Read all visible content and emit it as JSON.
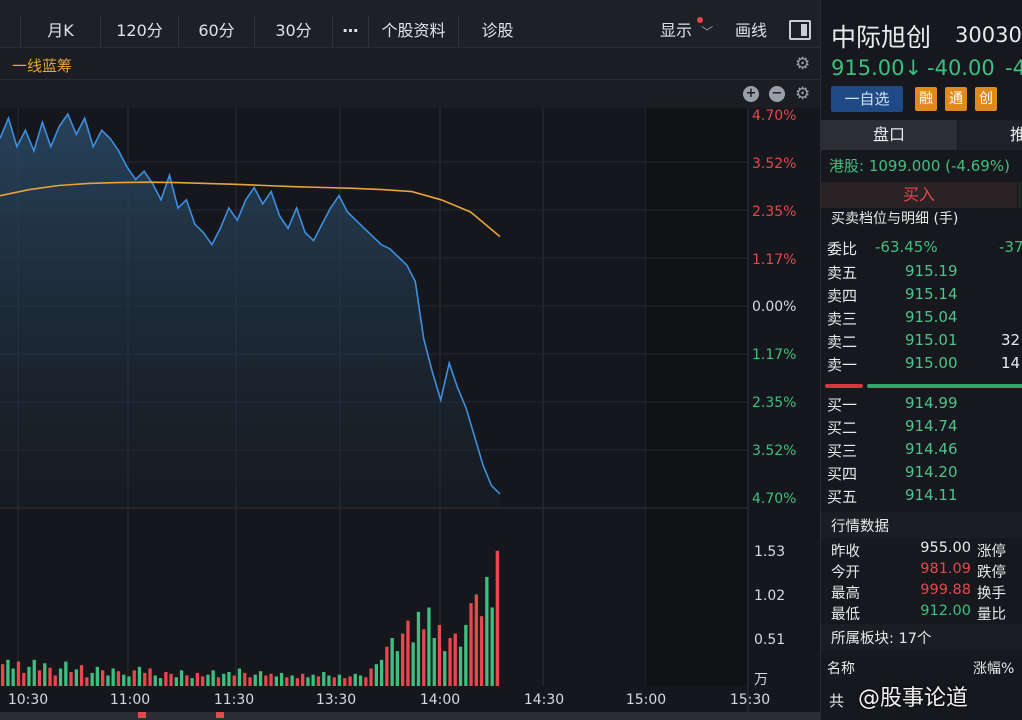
{
  "toolbar": {
    "buttons": [
      "月K",
      "120分",
      "60分",
      "30分",
      "⋯",
      "个股资料",
      "诊股"
    ],
    "display_label": "显示",
    "draw_label": "画线"
  },
  "indicator": {
    "name": "一线蓝筹"
  },
  "colors": {
    "up": "#e5484d",
    "down": "#3fbf7f",
    "price_line": "#3d8fe0",
    "avg_line": "#e8a33a",
    "accent": "#e8a33a"
  },
  "chart_data": [
    {
      "type": "line",
      "title": "",
      "x": [
        "10:30",
        "11:00",
        "11:30",
        "13:30",
        "14:00",
        "14:30",
        "15:00",
        "15:30"
      ],
      "y_tick_labels_up": [
        "4.70%",
        "3.52%",
        "2.35%",
        "1.17%"
      ],
      "y_tick_labels_mid": "0.00%",
      "y_tick_labels_down": [
        "1.17%",
        "2.35%",
        "3.52%",
        "4.70%"
      ],
      "ylim_percent": [
        -4.7,
        4.7
      ],
      "series": [
        {
          "values_percent": [
            4.1,
            4.6,
            3.9,
            4.3,
            3.8,
            4.5,
            3.9,
            4.4,
            4.7,
            4.2,
            4.6,
            3.9,
            4.3,
            4.1,
            3.8,
            3.4,
            3.1,
            3.3,
            3.0,
            2.6,
            3.2,
            2.4,
            2.6,
            2.0,
            1.8,
            1.5,
            1.9,
            2.4,
            2.1,
            2.6,
            2.9,
            2.5,
            2.8,
            2.2,
            1.9,
            2.4,
            1.8,
            1.6,
            2.0,
            2.4,
            2.7,
            2.3,
            2.1,
            1.9,
            1.7,
            1.5,
            1.4,
            1.2,
            1.0,
            0.6,
            -0.8,
            -1.6,
            -2.3,
            -1.4,
            -2.0,
            -2.5,
            -3.2,
            -3.9,
            -4.4,
            -4.6
          ],
          "color": "#3d8fe0"
        },
        {
          "values_percent": [
            2.7,
            2.85,
            2.95,
            3.0,
            3.02,
            3.03,
            3.02,
            3.0,
            2.98,
            2.95,
            2.92,
            2.9,
            2.88,
            2.85,
            2.8,
            2.6,
            2.3,
            1.7
          ],
          "color": "#e8a33a"
        }
      ]
    },
    {
      "type": "bar",
      "title": "",
      "ylabel": "万",
      "y_tick_labels": [
        "1.53",
        "1.02",
        "0.51"
      ],
      "ylim": [
        0,
        2.04
      ],
      "values": [
        0.25,
        0.3,
        0.2,
        0.28,
        0.15,
        0.22,
        0.3,
        0.18,
        0.26,
        0.21,
        0.12,
        0.2,
        0.28,
        0.16,
        0.19,
        0.24,
        0.1,
        0.15,
        0.22,
        0.18,
        0.12,
        0.2,
        0.17,
        0.13,
        0.11,
        0.18,
        0.22,
        0.15,
        0.2,
        0.12,
        0.09,
        0.16,
        0.14,
        0.1,
        0.18,
        0.12,
        0.09,
        0.15,
        0.11,
        0.13,
        0.18,
        0.1,
        0.14,
        0.16,
        0.12,
        0.2,
        0.15,
        0.1,
        0.13,
        0.17,
        0.12,
        0.14,
        0.11,
        0.15,
        0.1,
        0.12,
        0.09,
        0.14,
        0.1,
        0.13,
        0.11,
        0.16,
        0.12,
        0.1,
        0.13,
        0.09,
        0.11,
        0.14,
        0.12,
        0.1,
        0.2,
        0.25,
        0.3,
        0.45,
        0.55,
        0.4,
        0.6,
        0.75,
        0.5,
        0.85,
        0.65,
        0.9,
        0.55,
        0.7,
        0.4,
        0.55,
        0.6,
        0.45,
        0.7,
        0.95,
        1.05,
        0.8,
        1.25,
        0.9,
        1.55
      ],
      "up_down": "udduudduduudduduudduddudduduudduudduduuddudduduudduudduduuddudduduudduuddudduuddudduduudduu"
    }
  ],
  "stock": {
    "name": "中际旭创",
    "code": "30030",
    "price": "915.00↓",
    "change": "-40.00",
    "change_pct": "-4.",
    "watchlist_label": "一自选",
    "tags": [
      "融",
      "通",
      "创"
    ]
  },
  "panel_tabs": {
    "active": "盘口",
    "other": "推"
  },
  "hk": {
    "text": "港股: 1099.000 (-4.69%)"
  },
  "buy_label": "买入",
  "order_book_title": "买卖档位与明细 (手)",
  "weibi": {
    "label": "委比",
    "value": "-63.45%",
    "extra": "-37"
  },
  "asks": [
    {
      "label": "卖五",
      "price": "915.19",
      "vol": ""
    },
    {
      "label": "卖四",
      "price": "915.14",
      "vol": ""
    },
    {
      "label": "卖三",
      "price": "915.04",
      "vol": ""
    },
    {
      "label": "卖二",
      "price": "915.01",
      "vol": "32"
    },
    {
      "label": "卖一",
      "price": "915.00",
      "vol": "14"
    }
  ],
  "bids": [
    {
      "label": "买一",
      "price": "914.99",
      "vol": ""
    },
    {
      "label": "买二",
      "price": "914.74",
      "vol": ""
    },
    {
      "label": "买三",
      "price": "914.46",
      "vol": ""
    },
    {
      "label": "买四",
      "price": "914.20",
      "vol": ""
    },
    {
      "label": "买五",
      "price": "914.11",
      "vol": ""
    }
  ],
  "market_data": {
    "title": "行情数据",
    "rows": [
      {
        "l1": "昨收",
        "v1": "955.00",
        "c": "#e7e9ec",
        "l2": "涨停"
      },
      {
        "l1": "今开",
        "v1": "981.09",
        "c": "#e5484d",
        "l2": "跌停"
      },
      {
        "l1": "最高",
        "v1": "999.88",
        "c": "#e5484d",
        "l2": "换手"
      },
      {
        "l1": "最低",
        "v1": "912.00",
        "c": "#3fbf7f",
        "l2": "量比"
      }
    ]
  },
  "sector": {
    "title": "所属板块: 17个",
    "col_name": "名称",
    "col_change": "涨幅%"
  },
  "footer_row": "共",
  "watermark": "@股事论道"
}
